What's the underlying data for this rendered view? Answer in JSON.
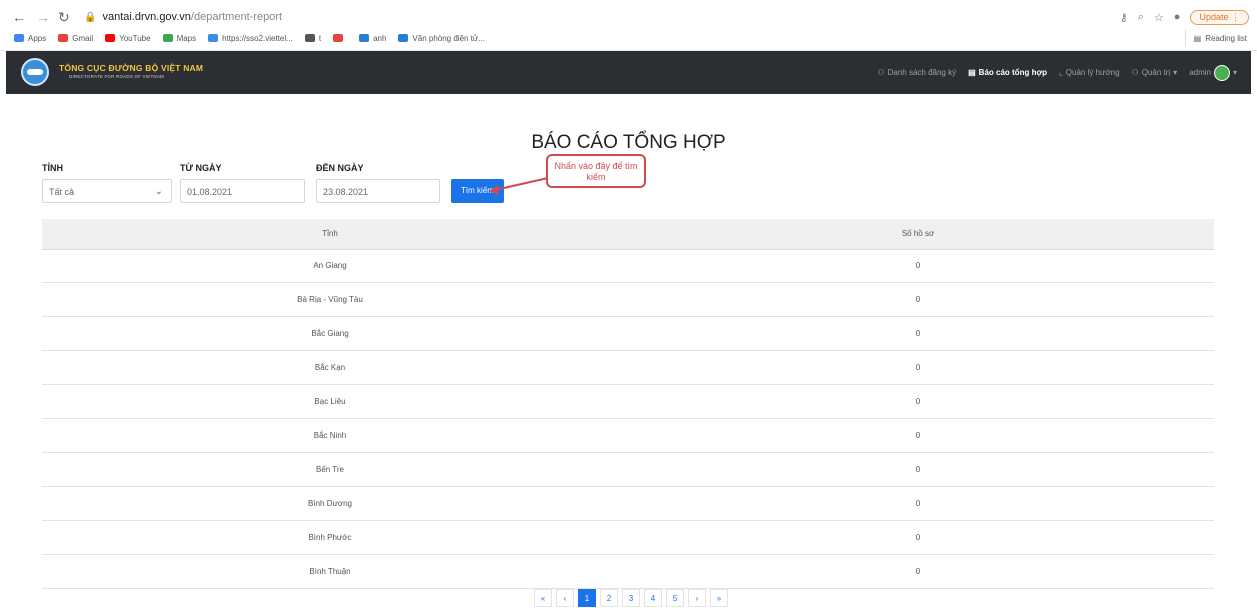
{
  "browser": {
    "url_domain": "vantai.drvn.gov.vn",
    "url_path": "/department-report",
    "update_label": "Update",
    "reading_list": "Reading list",
    "bookmarks": [
      {
        "label": "Apps",
        "icon": "apps-grid-icon",
        "color": "#4285f4"
      },
      {
        "label": "Gmail",
        "icon": "gmail-icon",
        "color": "#ea4335"
      },
      {
        "label": "YouTube",
        "icon": "youtube-icon",
        "color": "#ff0000"
      },
      {
        "label": "Maps",
        "icon": "maps-icon",
        "color": "#34a853"
      },
      {
        "label": "https://sso2.viettel...",
        "icon": "cloud-icon",
        "color": "#3a8ee6"
      },
      {
        "label": "t",
        "icon": "chrome-icon",
        "color": "#555555"
      },
      {
        "label": "",
        "icon": "flower-icon",
        "color": "#e8453c"
      },
      {
        "label": "anh",
        "icon": "bird-icon",
        "color": "#2b7cd3"
      },
      {
        "label": "Văn phòng điện tử...",
        "icon": "bird-icon",
        "color": "#2b7cd3"
      }
    ]
  },
  "header": {
    "brand_title": "TỔNG CỤC ĐƯỜNG BỘ VIỆT NAM",
    "brand_subtitle": "DIRECTORATE FOR ROADS OF VIETNAM",
    "menu": {
      "register_list": "Danh sách đăng ký",
      "summary_report": "Báo cáo tổng hợp",
      "guide_management": "Quản lý hướng",
      "admin_menu": "Quản trị",
      "user": "admin"
    }
  },
  "page": {
    "title": "BÁO CÁO TỔNG HỢP",
    "filters": {
      "province_label": "TỈNH",
      "province_value": "Tất cả",
      "from_label": "TỪ NGÀY",
      "from_value": "01.08.2021",
      "to_label": "ĐẾN NGÀY",
      "to_value": "23.08.2021",
      "search_button": "Tìm kiếm"
    },
    "callout": "Nhấn vào đây để tìm kiếm"
  },
  "table": {
    "headers": [
      "Tỉnh",
      "Số hồ sơ"
    ],
    "rows": [
      [
        "An Giang",
        "0"
      ],
      [
        "Bà Rịa - Vũng Tàu",
        "0"
      ],
      [
        "Bắc Giang",
        "0"
      ],
      [
        "Bắc Kạn",
        "0"
      ],
      [
        "Bạc Liêu",
        "0"
      ],
      [
        "Bắc Ninh",
        "0"
      ],
      [
        "Bến Tre",
        "0"
      ],
      [
        "Bình Dương",
        "0"
      ],
      [
        "Bình Phước",
        "0"
      ],
      [
        "Bình Thuận",
        "0"
      ]
    ]
  },
  "pagination": {
    "first": "«",
    "prev": "‹",
    "pages": [
      "1",
      "2",
      "3",
      "4",
      "5"
    ],
    "current": "1",
    "next": "›",
    "last": "»"
  }
}
